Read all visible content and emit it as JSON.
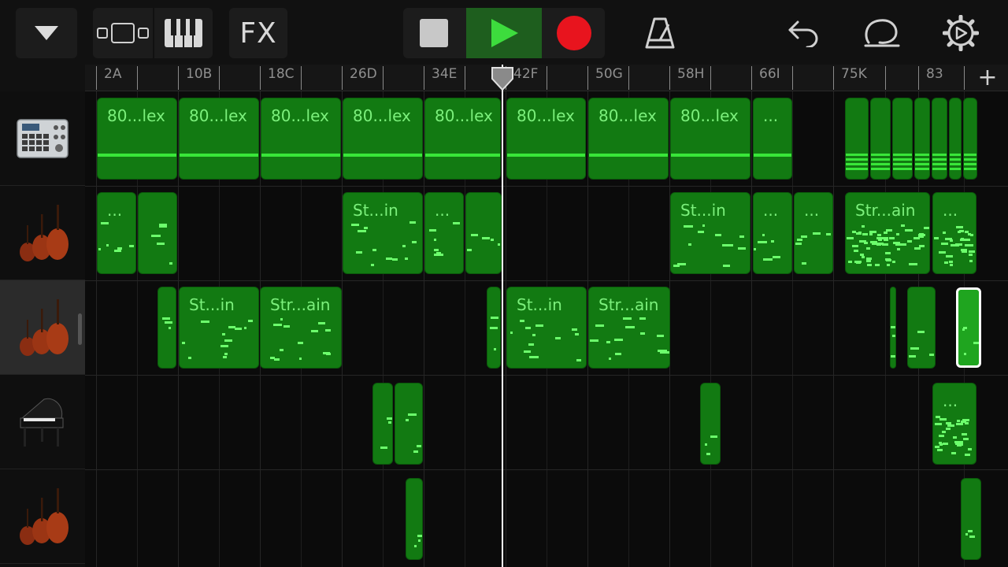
{
  "toolbar": {
    "fx_label": "FX"
  },
  "ruler": {
    "labels": [
      "2A",
      "10B",
      "18C",
      "26D",
      "34E",
      "42F",
      "50G",
      "58H",
      "66I",
      "75K",
      "83"
    ]
  },
  "tracks": [
    {
      "instrument": "drum-machine",
      "regions": [
        "80...lex",
        "80...lex",
        "80...lex",
        "80...lex",
        "80...lex",
        "80...lex",
        "80...lex",
        "80...lex",
        "..."
      ]
    },
    {
      "instrument": "strings",
      "regions": [
        "...",
        "St...in",
        "...",
        "St...in",
        "...",
        "...",
        "Str...ain",
        "..."
      ]
    },
    {
      "instrument": "strings",
      "regions": [
        "St...in",
        "Str...ain",
        "St...in",
        "Str...ain"
      ]
    },
    {
      "instrument": "grand-piano",
      "regions": [
        "..."
      ]
    },
    {
      "instrument": "strings",
      "regions": []
    }
  ],
  "colors": {
    "region": "#127a12",
    "note": "#6cff6c",
    "region_label": "#7cf07c",
    "record": "#e8141e",
    "play": "#3ddc3d"
  }
}
